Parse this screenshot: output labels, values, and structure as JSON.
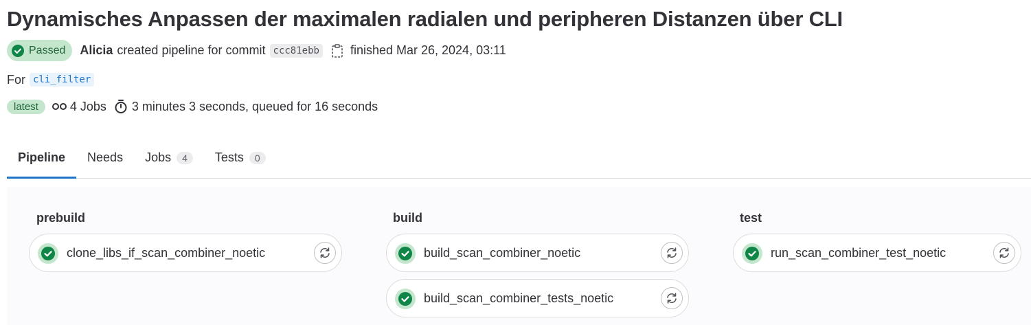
{
  "header": {
    "title": "Dynamisches Anpassen der maximalen radialen und peripheren Distanzen über CLI",
    "status": "Passed",
    "author": "Alicia",
    "action_text": "created pipeline for commit",
    "commit_sha": "ccc81ebb",
    "finished_text": "finished Mar 26, 2024, 03:11"
  },
  "ref": {
    "prefix": "For",
    "branch": "cli_filter"
  },
  "info": {
    "latest_label": "latest",
    "jobs_text": "4 Jobs",
    "duration_text": "3 minutes 3 seconds, queued for 16 seconds"
  },
  "tabs": [
    {
      "label": "Pipeline",
      "active": true
    },
    {
      "label": "Needs"
    },
    {
      "label": "Jobs",
      "count": "4"
    },
    {
      "label": "Tests",
      "count": "0"
    }
  ],
  "stages": [
    {
      "name": "prebuild",
      "jobs": [
        {
          "name": "clone_libs_if_scan_combiner_noetic",
          "status": "success"
        }
      ]
    },
    {
      "name": "build",
      "jobs": [
        {
          "name": "build_scan_combiner_noetic",
          "status": "success"
        },
        {
          "name": "build_scan_combiner_tests_noetic",
          "status": "success"
        }
      ]
    },
    {
      "name": "test",
      "jobs": [
        {
          "name": "run_scan_combiner_test_noetic",
          "status": "success"
        }
      ]
    }
  ],
  "colors": {
    "success": "#108548",
    "success_bg": "#c3e6cd",
    "accent": "#1f75cb"
  },
  "icons": {
    "status": "status-success-icon",
    "copy": "copy-to-clipboard-icon",
    "pipeline": "pipeline-icon",
    "timer": "timer-icon",
    "retry": "retry-icon"
  }
}
